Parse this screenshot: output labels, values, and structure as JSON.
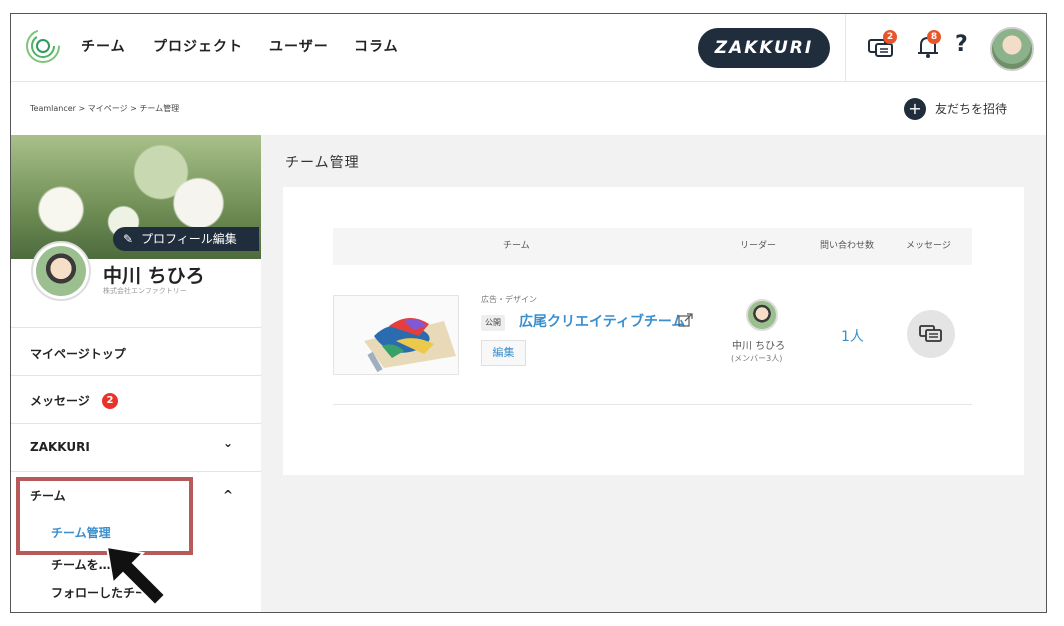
{
  "header": {
    "nav": [
      "チーム",
      "プロジェクト",
      "ユーザー",
      "コラム"
    ],
    "zakkuri_label": "ZAKKURI",
    "message_badge": "2",
    "notification_badge": "8",
    "help_label": "?"
  },
  "breadcrumb": {
    "text": "Teamlancer > マイページ > チーム管理",
    "invite_label": "友だちを招待",
    "invite_icon": "+"
  },
  "sidebar": {
    "edit_profile_label": "プロフィール編集",
    "profile_name": "中川 ちひろ",
    "company": "株式会社エンファクトリー",
    "items": [
      {
        "label": "マイページトップ"
      },
      {
        "label": "メッセージ",
        "badge": "2"
      },
      {
        "label": "ZAKKURI",
        "chevron": "⌄"
      },
      {
        "label": "チーム",
        "chevron": "^"
      }
    ],
    "sub_items": [
      "チーム管理",
      "チームを…",
      "フォローしたチーム"
    ]
  },
  "main": {
    "title": "チーム管理",
    "columns": [
      "チーム",
      "リーダー",
      "問い合わせ数",
      "メッセージ"
    ],
    "row": {
      "category": "広告・デザイン",
      "public_tag": "公開",
      "team_name": "広尾クリエイティブチーム",
      "edit_label": "編集",
      "leader_name": "中川 ちひろ",
      "members": "(メンバー3人)",
      "inquiry_count": "1人"
    }
  },
  "colors": {
    "accent_blue": "#3a8fcf",
    "navy": "#1f2d3d",
    "badge_red": "#e9332a",
    "highlight_box": "#b75a5a"
  }
}
